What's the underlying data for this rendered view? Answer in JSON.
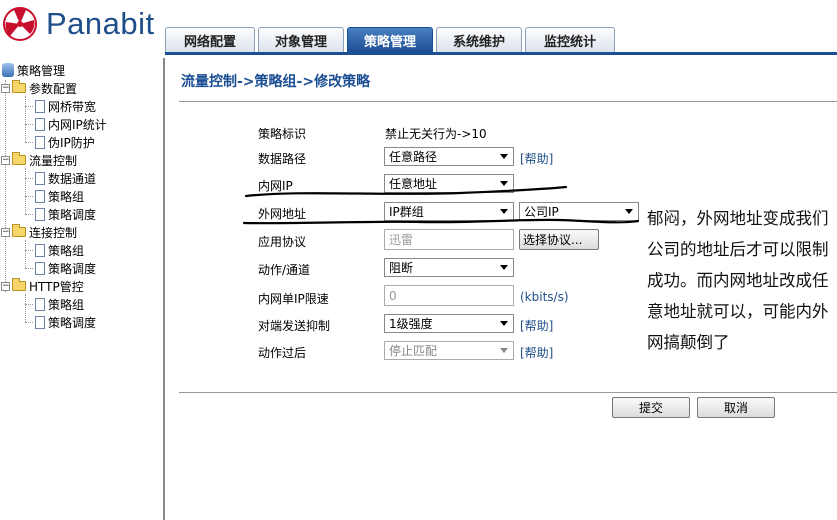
{
  "app": {
    "logo_text": "Panabit"
  },
  "tabs": [
    {
      "label": "网络配置"
    },
    {
      "label": "对象管理"
    },
    {
      "label": "策略管理"
    },
    {
      "label": "系统维护"
    },
    {
      "label": "监控统计"
    }
  ],
  "sidebar": {
    "root": "策略管理",
    "groups": [
      {
        "label": "参数配置",
        "items": [
          "网桥带宽",
          "内网IP统计",
          "伪IP防护"
        ]
      },
      {
        "label": "流量控制",
        "items": [
          "数据通道",
          "策略组",
          "策略调度"
        ]
      },
      {
        "label": "连接控制",
        "items": [
          "策略组",
          "策略调度"
        ]
      },
      {
        "label": "HTTP管控",
        "items": [
          "策略组",
          "策略调度"
        ]
      }
    ]
  },
  "form": {
    "title": "流量控制->策略组->修改策略",
    "policy_id_label": "策略标识",
    "policy_id_value": "禁止无关行为->10",
    "data_path_label": "数据路径",
    "data_path_value": "任意路径",
    "inner_ip_label": "内网IP",
    "inner_ip_value": "任意地址",
    "outer_addr_label": "外网地址",
    "outer_addr_value": "IP群组",
    "outer_addr_group_value": "公司IP",
    "app_protocol_label": "应用协议",
    "app_protocol_value": "迅雷",
    "select_protocol_button": "选择协议...",
    "action_label": "动作/通道",
    "action_value": "阻断",
    "inner_ip_limit_label": "内网单IP限速",
    "inner_ip_limit_value": "0",
    "inner_ip_limit_unit": "(kbits/s)",
    "peer_suppress_label": "对端发送抑制",
    "peer_suppress_value": "1级强度",
    "post_action_label": "动作过后",
    "post_action_value": "停止匹配",
    "help_link": "[帮助]",
    "submit_button": "提交",
    "cancel_button": "取消"
  },
  "annotation": {
    "text": "郁闷，外网地址变成我们公司的地址后才可以限制成功。而内网地址改成任意地址就可以，可能内外网搞颠倒了"
  },
  "colors": {
    "brand": "#1f4f8a",
    "active_tab": "#1b4e93",
    "logo_red": "#c8102e"
  }
}
